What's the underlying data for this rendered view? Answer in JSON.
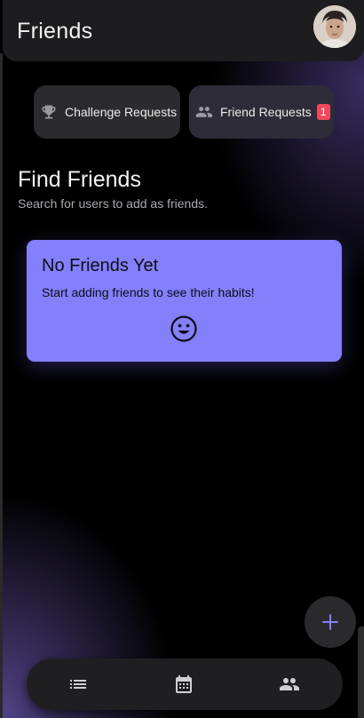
{
  "header": {
    "title": "Friends",
    "avatar_icon": "user-avatar-photo"
  },
  "requests": {
    "challenge": {
      "label": "Challenge Requests",
      "icon": "trophy-icon"
    },
    "friend": {
      "label": "Friend Requests",
      "icon": "people-icon",
      "badge_count": "1"
    }
  },
  "find": {
    "title": "Find Friends",
    "subtitle": "Search for users to add as friends."
  },
  "empty_state": {
    "title": "No Friends Yet",
    "description": "Start adding friends to see their habits!",
    "icon": "smiley-face-icon"
  },
  "fab": {
    "icon": "plus-icon"
  },
  "bottom_nav": {
    "items": [
      {
        "icon": "list-icon"
      },
      {
        "icon": "calendar-icon"
      },
      {
        "icon": "people-icon",
        "active": true
      }
    ]
  },
  "colors": {
    "accent": "#8480fc",
    "badge": "#ef4a5c",
    "header_bg": "#1d1d1f",
    "button_bg": "#2b2b2e"
  }
}
